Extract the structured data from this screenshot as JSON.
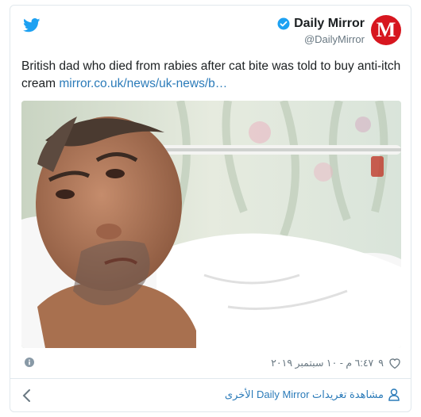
{
  "tweet": {
    "display_name": "Daily Mirror",
    "handle": "@DailyMirror",
    "avatar_letter": "M",
    "text": "British dad who died from rabies after cat bite was told to buy anti-itch cream ",
    "link_text": "mirror.co.uk/news/uk-news/b…",
    "timestamp": "٦:٤٧ م - ١٠ سبتمبر ٢٠١٩",
    "like_count": "٩"
  },
  "footer": {
    "more_tweets_label": "مشاهدة تغريدات Daily Mirror الأخرى"
  },
  "icons": {
    "logo": "twitter-bird-icon",
    "verified": "verified-badge-icon",
    "info": "info-icon",
    "like": "heart-icon",
    "back": "chevron-left-icon",
    "person": "person-icon"
  },
  "colors": {
    "twitter_blue": "#1da1f2",
    "link": "#2b7bb9",
    "brand_red": "#d7161f",
    "muted": "#697882"
  }
}
